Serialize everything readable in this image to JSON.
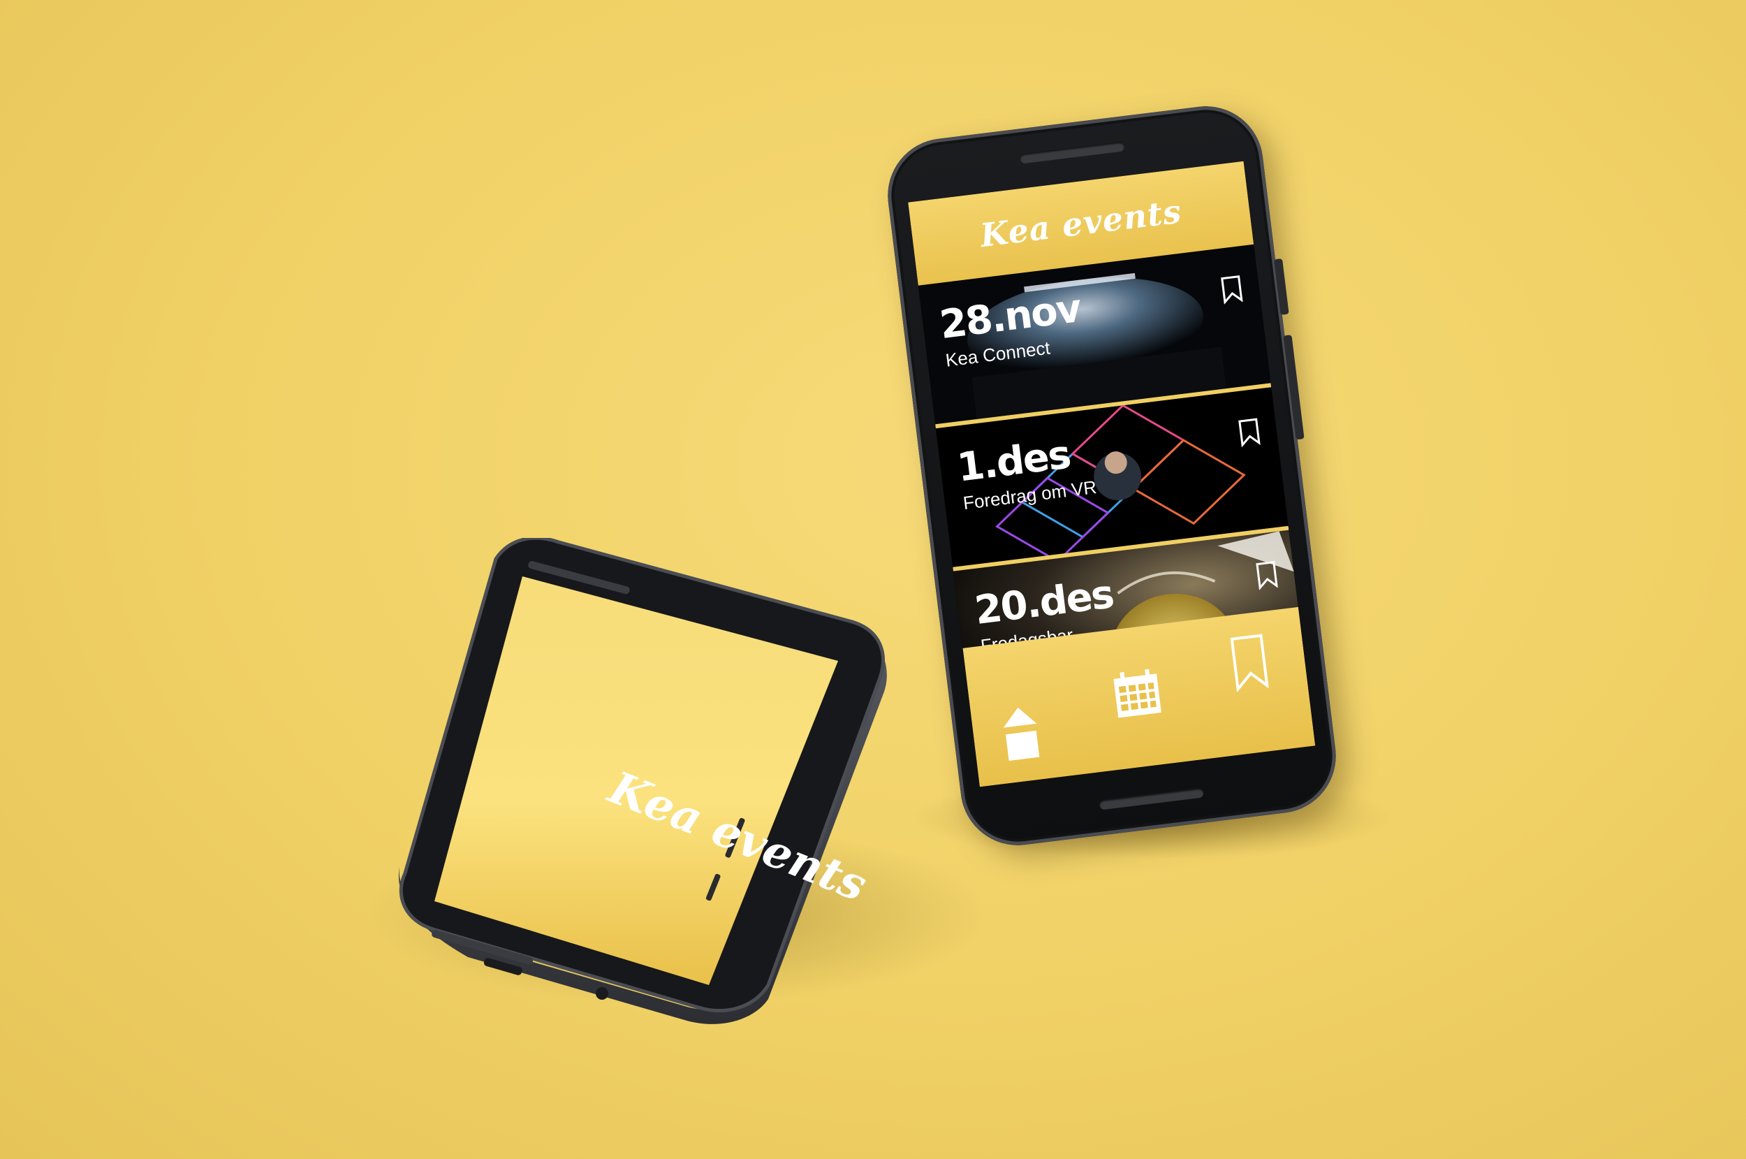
{
  "app": {
    "title": "Kea events"
  },
  "splash": {
    "title": "Kea events"
  },
  "events": [
    {
      "date": "28.nov",
      "name": "Kea Connect"
    },
    {
      "date": "1.des",
      "name": "Foredrag om VR"
    },
    {
      "date": "20.des",
      "name": "Fredagsbar"
    }
  ],
  "tabs": [
    {
      "icon": "home-icon"
    },
    {
      "icon": "calendar-icon"
    },
    {
      "icon": "bookmark-icon"
    }
  ],
  "colors": {
    "background": "#f0d166",
    "accent": "#f0cf63",
    "screen": "#000000"
  }
}
